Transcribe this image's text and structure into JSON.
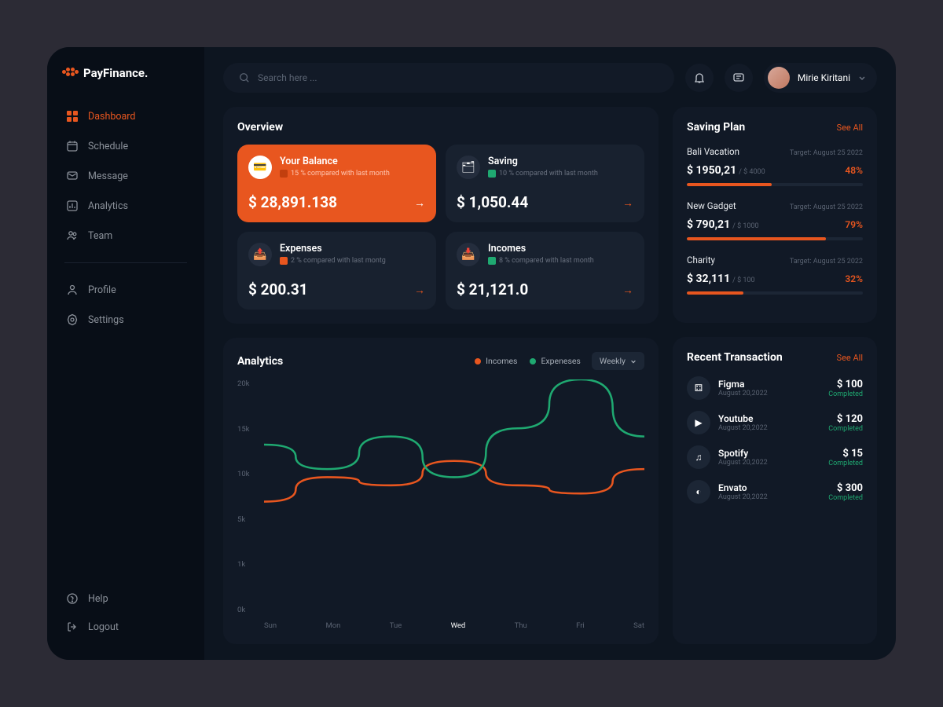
{
  "brand": "PayFinance.",
  "search": {
    "placeholder": "Search here ..."
  },
  "user": {
    "name": "Mirie Kiritani"
  },
  "sidebar": {
    "main": [
      {
        "label": "Dashboard",
        "active": true
      },
      {
        "label": "Schedule"
      },
      {
        "label": "Message"
      },
      {
        "label": "Analytics"
      },
      {
        "label": "Team"
      }
    ],
    "secondary": [
      {
        "label": "Profile"
      },
      {
        "label": "Settings"
      }
    ],
    "footer": [
      {
        "label": "Help"
      },
      {
        "label": "Logout"
      }
    ]
  },
  "overview": {
    "title": "Overview",
    "cards": [
      {
        "label": "Your Balance",
        "sub": "15 % compared with last month",
        "value": "$ 28,891.138",
        "dir": "down",
        "accent": true
      },
      {
        "label": "Saving",
        "sub": "10 % compared with last month",
        "value": "$ 1,050.44",
        "dir": "up"
      },
      {
        "label": "Expenses",
        "sub": "2 % compared with last montg",
        "value": "$ 200.31",
        "dir": "down"
      },
      {
        "label": "Incomes",
        "sub": "8 % compared with last month",
        "value": "$ 21,121.0",
        "dir": "up"
      }
    ]
  },
  "analytics": {
    "title": "Analytics",
    "legend": [
      "Incomes",
      "Expeneses"
    ],
    "selector": "Weekly"
  },
  "saving": {
    "title": "Saving Plan",
    "link": "See All",
    "plans": [
      {
        "name": "Bali Vacation",
        "target": "Target: August 25 2022",
        "amount": "$ 1950,21",
        "total": "/ $  4000",
        "pct": "48%",
        "fill": 48
      },
      {
        "name": "New Gadget",
        "target": "Target: August 25 2022",
        "amount": "$ 790,21",
        "total": "/ $  1000",
        "pct": "79%",
        "fill": 79
      },
      {
        "name": "Charity",
        "target": "Target: August 25 2022",
        "amount": "$ 32,111",
        "total": "/ $  100",
        "pct": "32%",
        "fill": 32
      }
    ]
  },
  "transactions": {
    "title": "Recent Transaction",
    "link": "See All",
    "items": [
      {
        "name": "Figma",
        "date": "August  20,2022",
        "amount": "$  100",
        "status": "Completed"
      },
      {
        "name": "Youtube",
        "date": "August  20,2022",
        "amount": "$  120",
        "status": "Completed"
      },
      {
        "name": "Spotify",
        "date": "August  20,2022",
        "amount": "$  15",
        "status": "Completed"
      },
      {
        "name": "Envato",
        "date": "August  20,2022",
        "amount": "$  300",
        "status": "Completed"
      }
    ]
  },
  "chart_data": {
    "type": "line",
    "title": "Analytics",
    "xlabel": "",
    "ylabel": "",
    "categories": [
      "Sun",
      "Mon",
      "Tue",
      "Wed",
      "Thu",
      "Fri",
      "Sat"
    ],
    "yticks": [
      "20k",
      "15k",
      "10k",
      "5k",
      "1k",
      "0k"
    ],
    "ylim": [
      0,
      20
    ],
    "series": [
      {
        "name": "Incomes",
        "color": "#e8561f",
        "values": [
          5,
          8,
          7,
          10,
          7,
          6,
          9
        ]
      },
      {
        "name": "Expeneses",
        "color": "#1fa971",
        "values": [
          12,
          9,
          13,
          8,
          14,
          20,
          13
        ]
      }
    ]
  },
  "colors": {
    "accent": "#e8561f",
    "green": "#1fa971"
  }
}
